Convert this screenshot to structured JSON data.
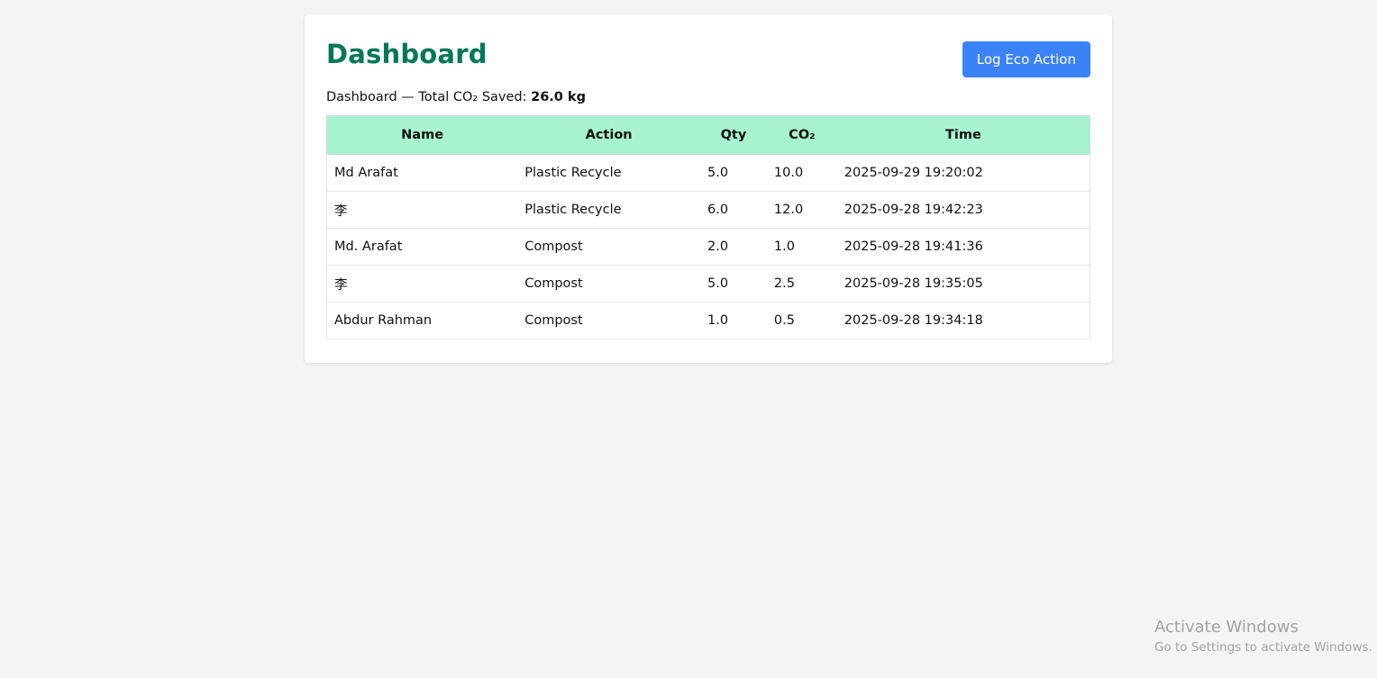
{
  "header": {
    "title": "Dashboard",
    "log_button_label": "Log Eco Action"
  },
  "summary": {
    "prefix": "Dashboard — Total CO₂ Saved: ",
    "total": "26.0 kg"
  },
  "table": {
    "columns": [
      "Name",
      "Action",
      "Qty",
      "CO₂",
      "Time"
    ],
    "rows": [
      {
        "name": "Md Arafat",
        "action": "Plastic Recycle",
        "qty": "5.0",
        "co2": "10.0",
        "time": "2025-09-29 19:20:02"
      },
      {
        "name": "李",
        "action": "Plastic Recycle",
        "qty": "6.0",
        "co2": "12.0",
        "time": "2025-09-28 19:42:23"
      },
      {
        "name": "Md. Arafat",
        "action": "Compost",
        "qty": "2.0",
        "co2": "1.0",
        "time": "2025-09-28 19:41:36"
      },
      {
        "name": "李",
        "action": "Compost",
        "qty": "5.0",
        "co2": "2.5",
        "time": "2025-09-28 19:35:05"
      },
      {
        "name": "Abdur Rahman",
        "action": "Compost",
        "qty": "1.0",
        "co2": "0.5",
        "time": "2025-09-28 19:34:18"
      }
    ]
  },
  "watermark": {
    "title": "Activate Windows",
    "subtitle": "Go to Settings to activate Windows."
  },
  "colors": {
    "title": "#047857",
    "button": "#3b82f6",
    "table_header": "#a7f3d0",
    "background": "#f3f4f6"
  }
}
